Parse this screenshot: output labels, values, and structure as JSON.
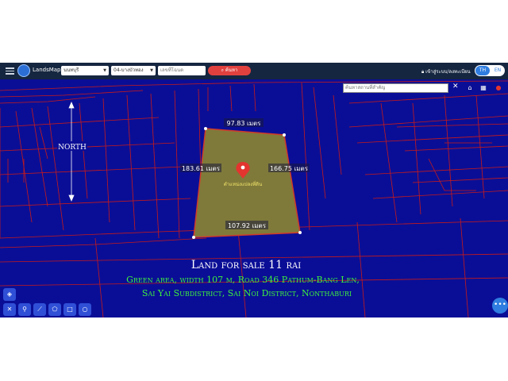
{
  "header": {
    "app_name": "LandsMaps",
    "province_value": "นนทบุรี",
    "district_value": "04-บางบัวทอง",
    "parcel_placeholder": "เลขที่โฉนด",
    "search_label": "ค้นหา",
    "login_label": "เข้าสู่ระบบ/ลงทะเบียน",
    "lang_th": "TH",
    "lang_en": "EN"
  },
  "map": {
    "place_search_placeholder": "ค้นหาสถานที่สำคัญ",
    "north_label": "NORTH",
    "edge_top": "97.83 เมตร",
    "edge_left": "183.61 เมตร",
    "edge_right": "166.75 เมตร",
    "edge_bottom": "107.92 เมตร",
    "pin_label": "ตำแหน่งแปลงที่ดิน",
    "colors": {
      "background": "#0a0e96",
      "lines": "#c81a1a",
      "parcel": "#7f7a3a",
      "pin": "#e3342f"
    }
  },
  "caption": {
    "line1": "Land for sale 11 rai",
    "line2": "Green area, width 107 m, Road 346 Pathum-Bang Len,",
    "line3": "Sai Yai Subdistrict, Sai Noi District, Nonthaburi"
  },
  "tools": {
    "left_icons": [
      "layers-icon",
      "ruler-icon",
      "pin-icon",
      "line-icon",
      "polygon-icon",
      "square-icon",
      "circle-icon"
    ],
    "right_icons": [
      "home-icon",
      "building-icon",
      "location-icon"
    ]
  }
}
